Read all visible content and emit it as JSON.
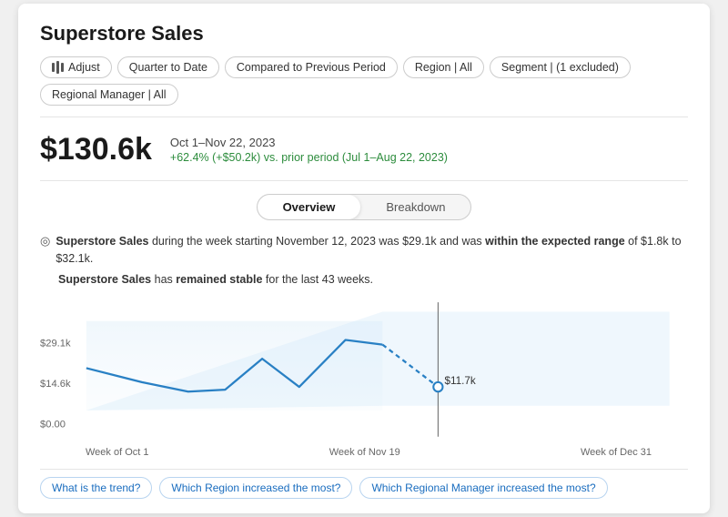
{
  "title": "Superstore Sales",
  "filters": [
    {
      "id": "adjust",
      "label": "Adjust",
      "icon": true
    },
    {
      "id": "quarter",
      "label": "Quarter to Date"
    },
    {
      "id": "compared",
      "label": "Compared to Previous Period"
    },
    {
      "id": "region",
      "label": "Region | All"
    },
    {
      "id": "segment",
      "label": "Segment | (1 excluded)"
    },
    {
      "id": "regional-manager",
      "label": "Regional Manager | All"
    }
  ],
  "metric": {
    "value": "$130.6k",
    "period": "Oct 1–Nov 22, 2023",
    "change": "+62.4% (+$50.2k) vs. prior period (Jul 1–Aug 22, 2023)"
  },
  "tabs": [
    {
      "id": "overview",
      "label": "Overview",
      "active": true
    },
    {
      "id": "breakdown",
      "label": "Breakdown",
      "active": false
    }
  ],
  "insight": {
    "main": "Superstore Sales during the week starting November 12, 2023 was $29.1k and was within the expected range of $1.8k to $32.1k.",
    "stable": "Superstore Sales has remained stable for the last 43 weeks."
  },
  "chart": {
    "y_labels": [
      "$29.1k",
      "$14.6k",
      "$0.00"
    ],
    "x_labels": [
      "Week of Oct 1",
      "Week of Nov 19",
      "Week of Dec 31"
    ],
    "data_label": "$11.7k"
  },
  "quick_links": [
    "What is the trend?",
    "Which Region increased the most?",
    "Which Regional Manager increased the most?"
  ]
}
